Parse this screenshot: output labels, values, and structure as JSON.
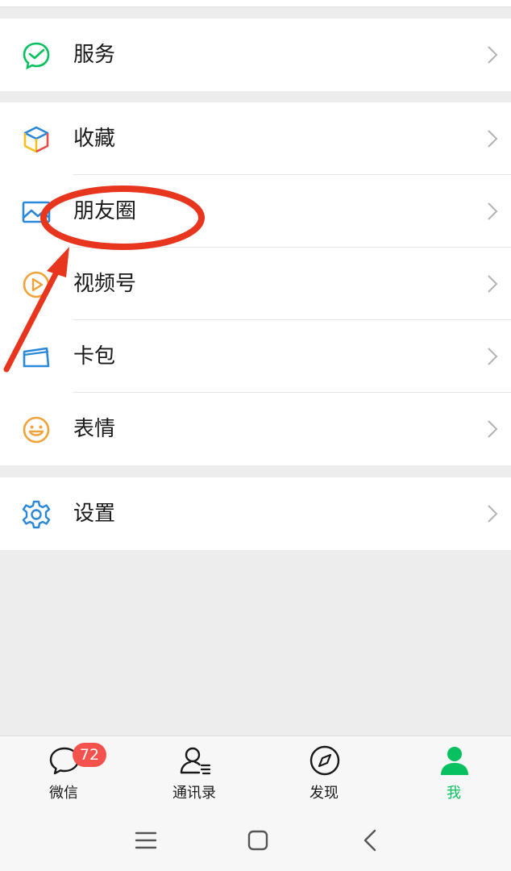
{
  "groups": [
    {
      "rows": [
        {
          "label": "服务",
          "icon": "service-check-icon",
          "color": "#07c160"
        }
      ]
    },
    {
      "rows": [
        {
          "label": "收藏",
          "icon": "favorites-cube-icon"
        },
        {
          "label": "朋友圈",
          "icon": "moments-image-icon",
          "color": "#2a88d8"
        },
        {
          "label": "视频号",
          "icon": "channels-play-icon",
          "color": "#f0a33a"
        },
        {
          "label": "卡包",
          "icon": "card-wallet-icon",
          "color": "#2a88d8"
        },
        {
          "label": "表情",
          "icon": "sticker-smile-icon",
          "color": "#f0a33a"
        }
      ]
    },
    {
      "rows": [
        {
          "label": "设置",
          "icon": "settings-gear-icon",
          "color": "#2a88d8"
        }
      ]
    }
  ],
  "tabbar": {
    "tabs": [
      {
        "label": "微信",
        "icon": "chat-bubble-icon"
      },
      {
        "label": "通讯录",
        "icon": "contacts-icon"
      },
      {
        "label": "发现",
        "icon": "discover-compass-icon"
      },
      {
        "label": "我",
        "icon": "me-person-icon",
        "active": true
      }
    ],
    "badge": "72",
    "active_color": "#07c160",
    "badge_color": "#f5524e"
  },
  "annotation": {
    "color": "#e8351e",
    "shape": "ellipse-with-arrow"
  }
}
